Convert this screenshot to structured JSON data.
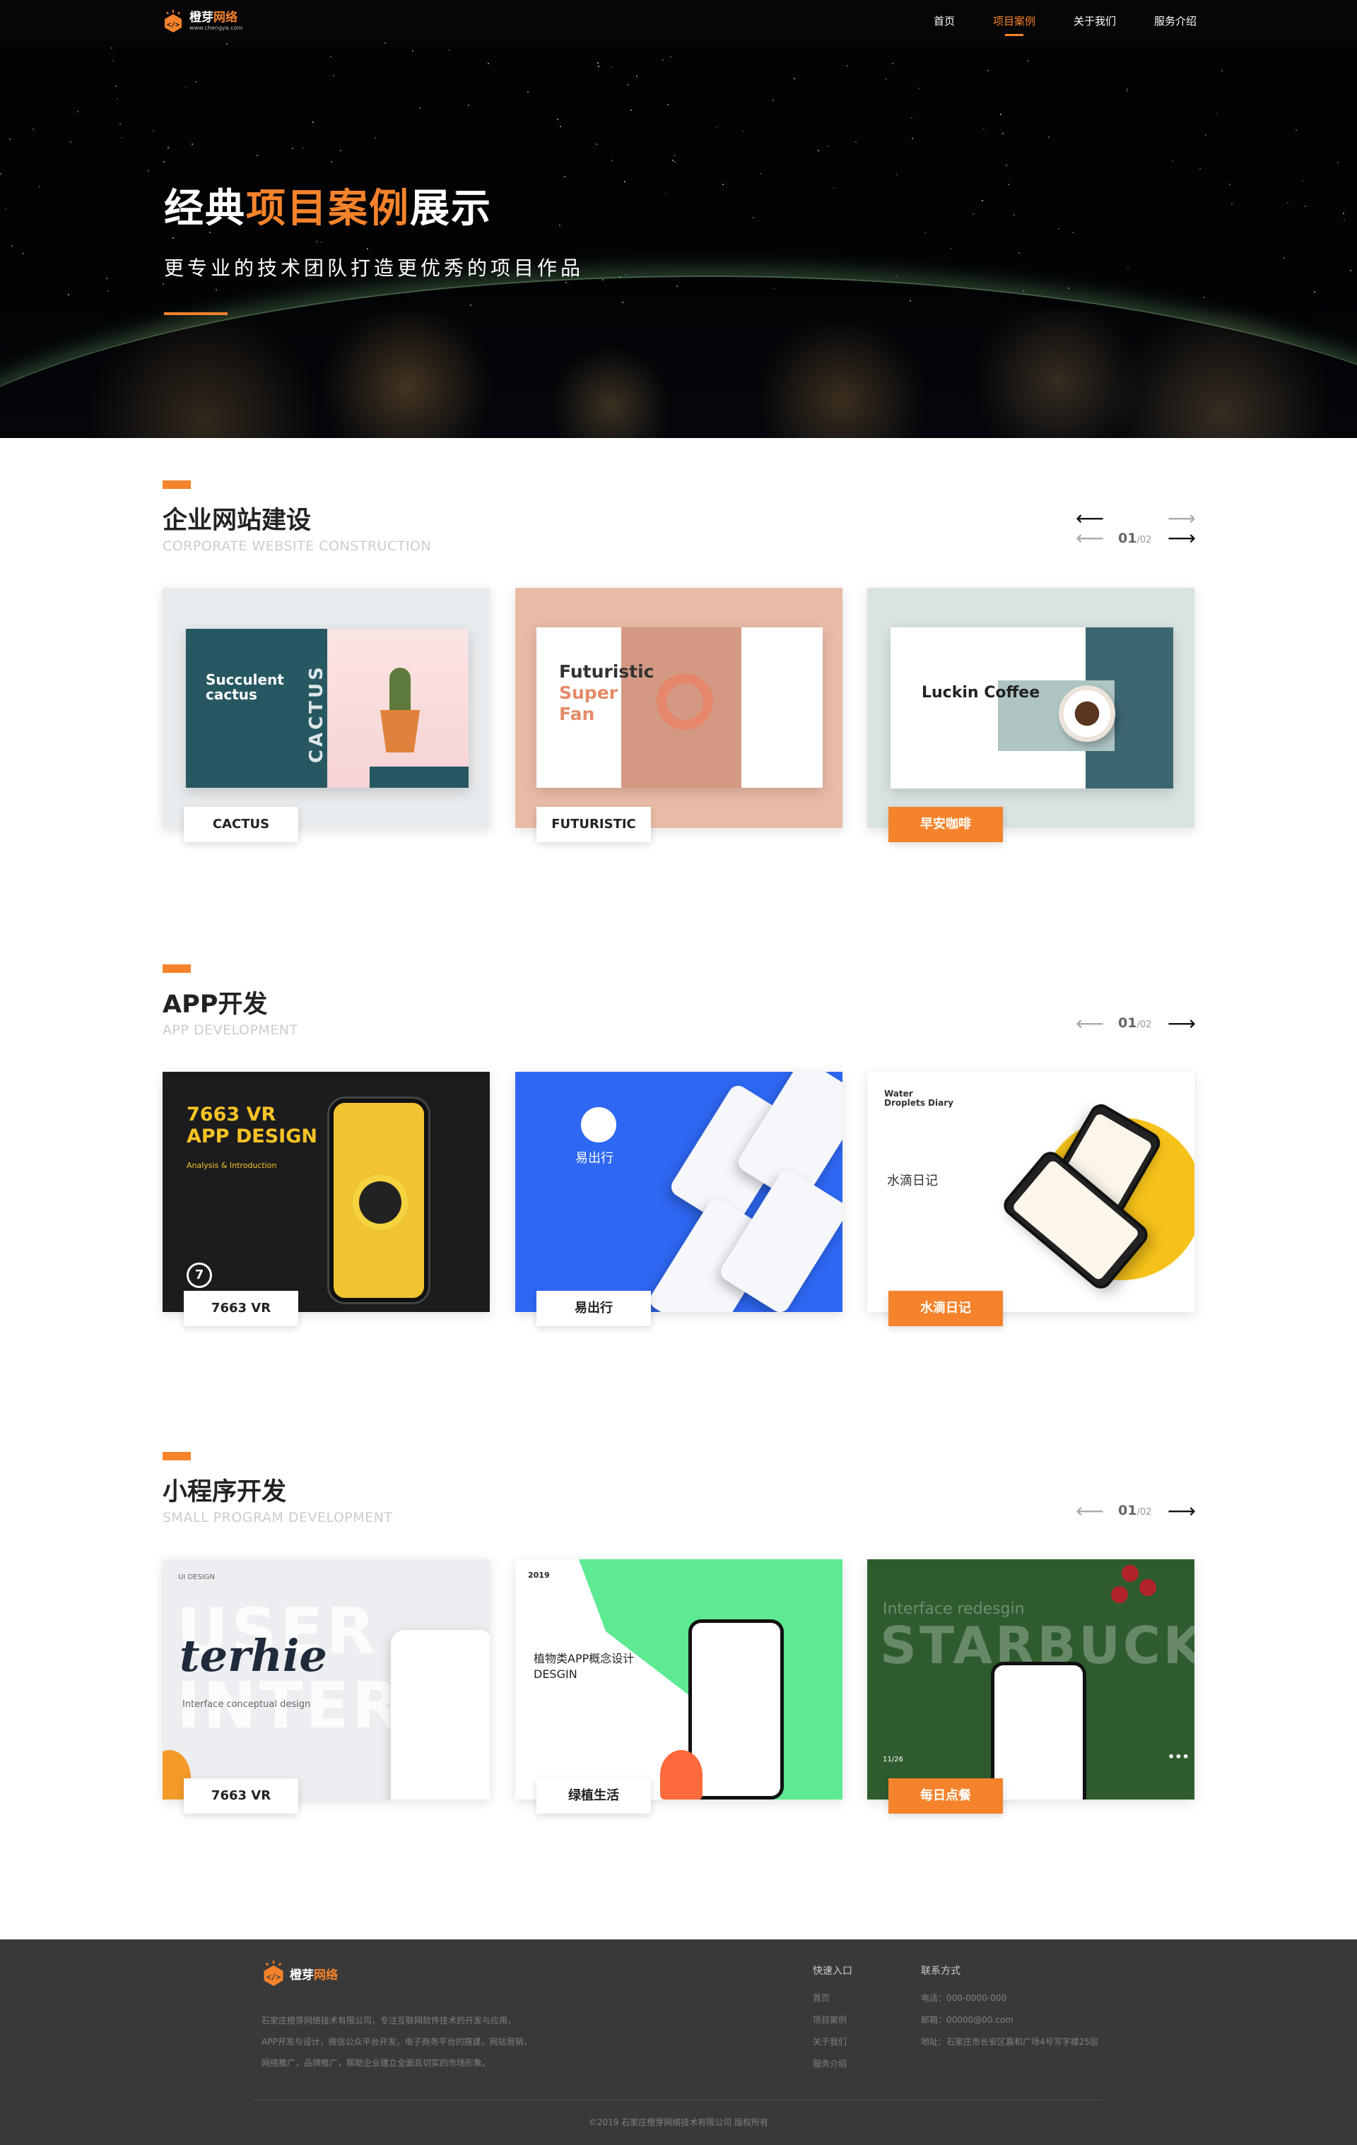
{
  "nav": {
    "logo_main_a": "橙芽",
    "logo_main_b": "网络",
    "logo_url": "www.chengya.com",
    "links": [
      {
        "label": "首页",
        "active": false
      },
      {
        "label": "项目案例",
        "active": true
      },
      {
        "label": "关于我们",
        "active": false
      },
      {
        "label": "服务介绍",
        "active": false
      }
    ]
  },
  "hero": {
    "title_a": "经典",
    "title_highlight": "项目案例",
    "title_b": "展示",
    "subtitle": "更专业的技术团队打造更优秀的项目作品"
  },
  "colors": {
    "accent": "#f5832b",
    "nav_bg": "#060606",
    "footer_bg": "#393939"
  },
  "sections": {
    "web": {
      "title": "企业网站建设",
      "subtitle": "CORPORATE WEBSITE CONSTRUCTION",
      "page_current": "01",
      "page_total": "/02",
      "prev_icon": "arrow-left-icon",
      "next_icon": "arrow-right-icon",
      "cards": [
        {
          "label": "CACTUS",
          "highlighted": false,
          "mock_title": "Succulent cactus",
          "mock_vertical": "CACTUS"
        },
        {
          "label": "FUTURISTIC",
          "highlighted": false,
          "mock_title_a": "Futuristic",
          "mock_title_b": "Super",
          "mock_title_c": "Fan"
        },
        {
          "label": "早安咖啡",
          "highlighted": true,
          "mock_title": "Luckin Coffee"
        }
      ]
    },
    "app": {
      "title": "APP开发",
      "subtitle": "APP DEVELOPMENT",
      "page_current": "01",
      "page_total": "/02",
      "cards": [
        {
          "label": "7663 VR",
          "highlighted": false,
          "mock_title_a": "7663 VR",
          "mock_title_b": "APP DESIGN",
          "mock_sub": "Analysis & Introduction",
          "mock_badge": "7"
        },
        {
          "label": "易出行",
          "highlighted": false,
          "mock_title": "易出行"
        },
        {
          "label": "水滴日记",
          "highlighted": true,
          "mock_title": "水滴日记",
          "mock_corner_a": "Water",
          "mock_corner_b": "Droplets Diary"
        }
      ]
    },
    "mini": {
      "title": "小程序开发",
      "subtitle": "SMALL PROGRAM DEVELOPMENT",
      "page_current": "01",
      "page_total": "/02",
      "cards": [
        {
          "label": "7663 VR",
          "highlighted": false,
          "mock_tag": "UI DESIGN",
          "mock_bg": "USER INTERFACE",
          "mock_script": "terhie",
          "mock_sub": "Interface conceptual design"
        },
        {
          "label": "绿植生活",
          "highlighted": false,
          "mock_year": "2019",
          "mock_title_a": "植物类APP概念设计",
          "mock_title_b": "DESGIN"
        },
        {
          "label": "每日点餐",
          "highlighted": true,
          "mock_top": "Interface redesgin",
          "mock_big": "STARBUCKS",
          "mock_date": "11/26",
          "mock_more": "•••"
        }
      ]
    }
  },
  "footer": {
    "logo_a": "橙芽",
    "logo_b": "网络",
    "desc_lines": [
      "石家庄橙芽网络技术有限公司，专注互联网软件技术的开发与应用，",
      "APP开发与设计，微信公众平台开发，电子商务平台的搭建，网站营销，",
      "网络推广，品牌推广，帮助企业建立全面且切实的市场形象。"
    ],
    "quick_title": "快速入口",
    "quick_links": [
      "首页",
      "项目案例",
      "关于我们",
      "服务介绍"
    ],
    "contact_title": "联系方式",
    "contact_lines": [
      "电话：000-0000-000",
      "邮箱：00000@00.com",
      "地址：石家庄市长安区嘉和广场4号写字楼25层"
    ],
    "copyright": "©2019  石家庄橙芽网络技术有限公司  版权所有"
  }
}
